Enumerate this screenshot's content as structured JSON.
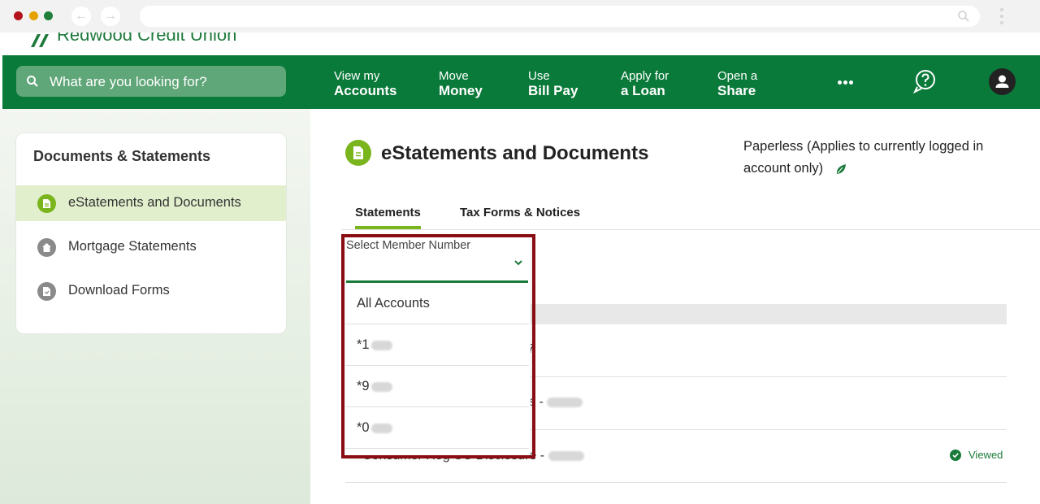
{
  "browser": {
    "back_icon": "arrow-left-icon",
    "forward_icon": "arrow-right-icon"
  },
  "brand": {
    "name": "Redwood Credit Union",
    "color": "#0a7a3a",
    "accent": "#7ab51d"
  },
  "header": {
    "search_placeholder": "What are you looking for?",
    "nav": [
      {
        "line1": "View my",
        "line2": "Accounts"
      },
      {
        "line1": "Move",
        "line2": "Money"
      },
      {
        "line1": "Use",
        "line2": "Bill Pay"
      },
      {
        "line1": "Apply for",
        "line2": "a Loan"
      },
      {
        "line1": "Open a",
        "line2": "Share"
      }
    ],
    "more_icon": "more-dots-icon",
    "help_icon": "chat-help-icon",
    "profile_icon": "user-avatar-icon"
  },
  "sidebar": {
    "title": "Documents & Statements",
    "items": [
      {
        "label": "eStatements and Documents",
        "active": true,
        "icon": "document-icon"
      },
      {
        "label": "Mortgage Statements",
        "active": false,
        "icon": "home-icon"
      },
      {
        "label": "Download Forms",
        "active": false,
        "icon": "download-form-icon"
      }
    ]
  },
  "main": {
    "title": "eStatements and Documents",
    "paperless_text": "Paperless (Applies to currently logged in account only)",
    "tabs": [
      {
        "label": "Statements",
        "active": true
      },
      {
        "label": "Tax Forms & Notices",
        "active": false
      }
    ],
    "rows": [
      {
        "partial_text": "7"
      },
      {
        "partial_text": "s -"
      },
      {
        "text": "Consumer Reg CC Disclosure -",
        "status": "Viewed"
      }
    ]
  },
  "member_select": {
    "label": "Select Member Number",
    "options": [
      "All Accounts",
      "*1",
      "*9",
      "*0"
    ]
  }
}
